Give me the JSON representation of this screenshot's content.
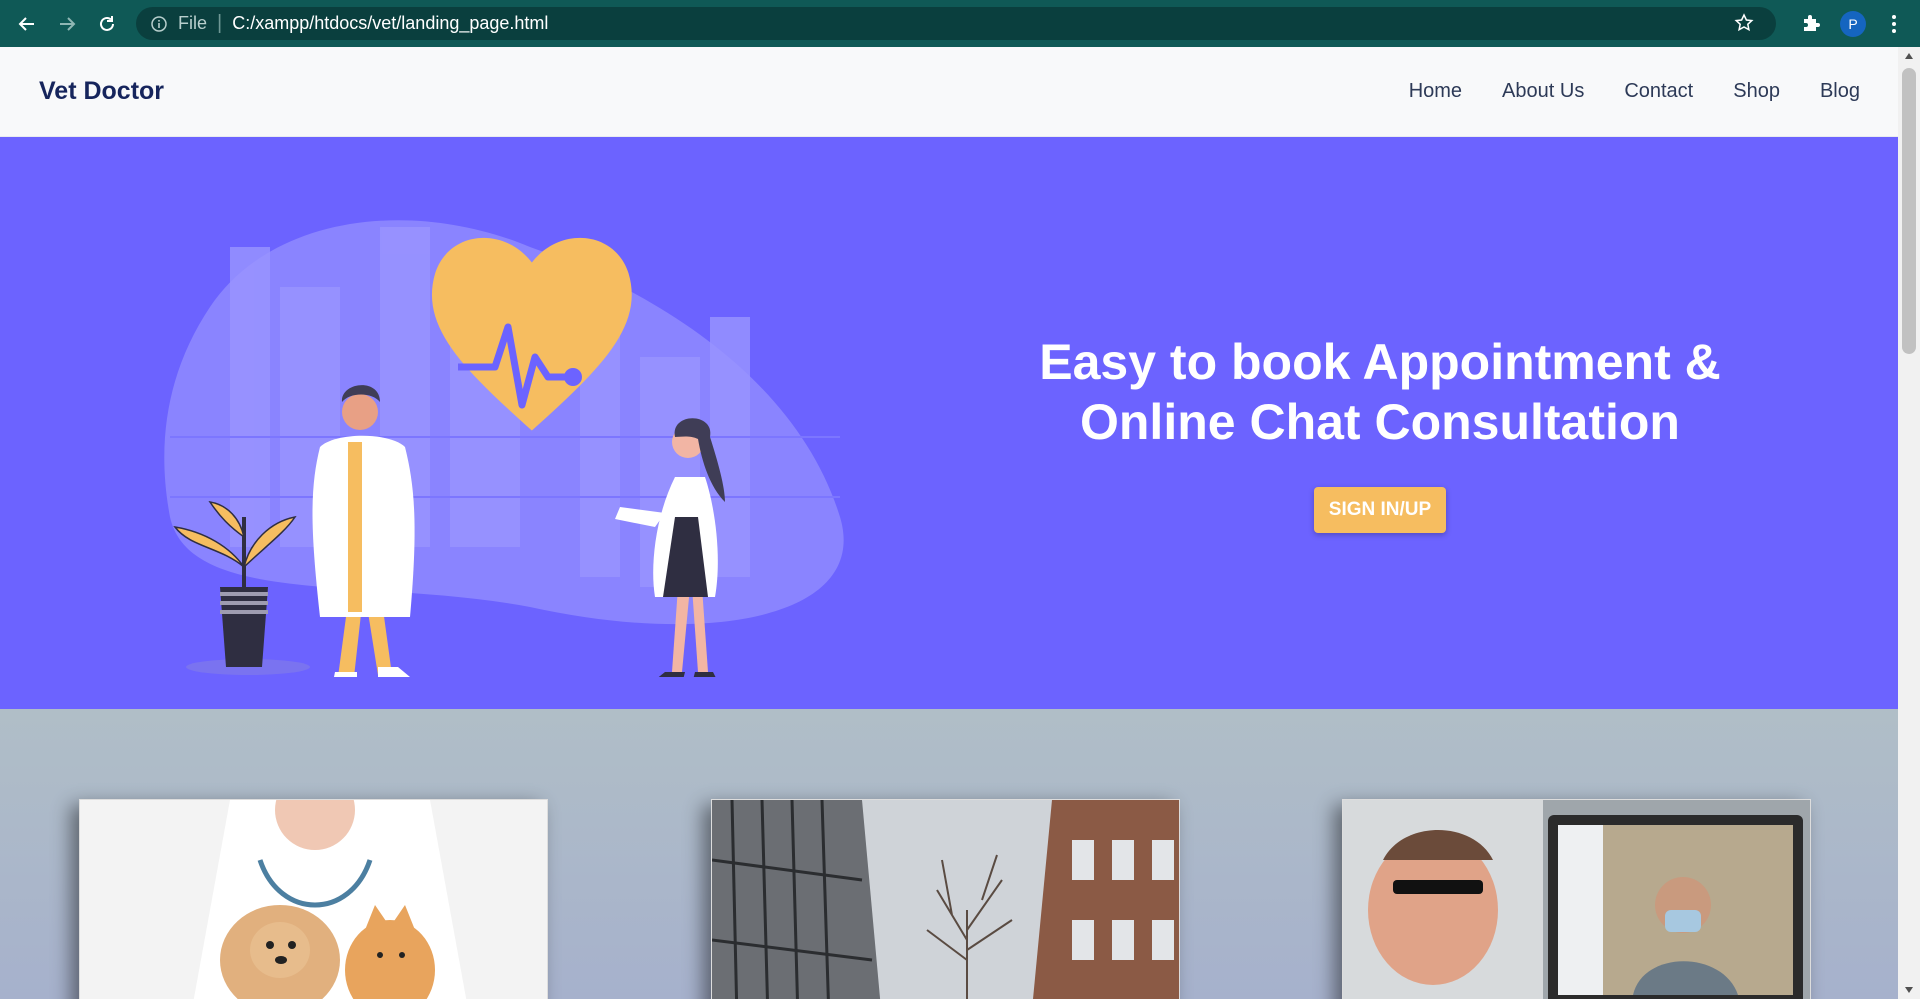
{
  "browser": {
    "file_label": "File",
    "url": "C:/xampp/htdocs/vet/landing_page.html",
    "profile_initial": "P"
  },
  "nav": {
    "brand": "Vet Doctor",
    "links": [
      "Home",
      "About Us",
      "Contact",
      "Shop",
      "Blog"
    ]
  },
  "hero": {
    "title_line1": "Easy to book Appointment &",
    "title_line2": "Online Chat Consultation",
    "cta_label": "SIGN IN/UP",
    "bg_color": "#6c63ff",
    "accent_color": "#f6bd60"
  },
  "cards": [
    {
      "image": "vet-with-pets-photo"
    },
    {
      "image": "clinic-building-photo"
    },
    {
      "image": "online-consultation-photo"
    }
  ]
}
